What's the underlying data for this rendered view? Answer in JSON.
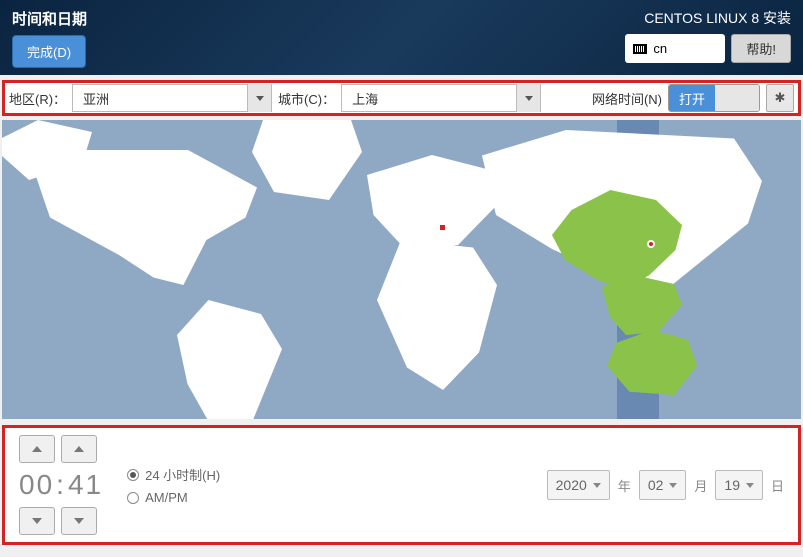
{
  "header": {
    "page_title": "时间和日期",
    "done_label": "完成(D)",
    "installer_title": "CENTOS LINUX 8 安装",
    "lang_code": "cn",
    "help_label": "帮助!"
  },
  "filter": {
    "region_label": "地区(R)：",
    "region_value": "亚洲",
    "city_label": "城市(C)：",
    "city_value": "上海",
    "ntp_label": "网络时间(N)",
    "toggle_on": "打开"
  },
  "time": {
    "hours": "00",
    "sep": ":",
    "minutes": "41",
    "fmt24": "24 小时制(H)",
    "fmtampm": "AM/PM"
  },
  "date": {
    "year": "2020",
    "year_label": "年",
    "month": "02",
    "month_label": "月",
    "day": "19",
    "day_label": "日"
  }
}
